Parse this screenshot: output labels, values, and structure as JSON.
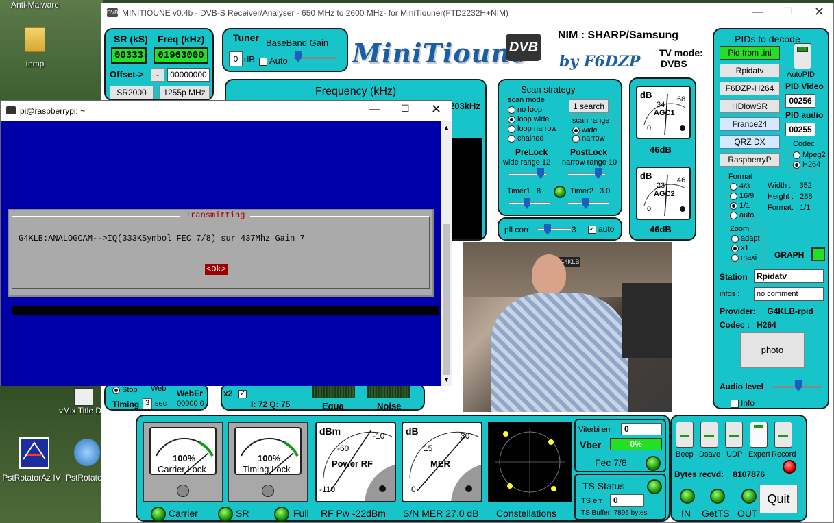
{
  "desktop": {
    "top_label": "Anti-Malware",
    "icons": [
      {
        "label": "temp"
      },
      {
        "label": "vMix Title Designer"
      },
      {
        "label": "PstRotatorAz IV"
      },
      {
        "label": "PstRotato..."
      }
    ]
  },
  "window": {
    "title": "MINITIOUNE v0.4b - DVB-S Receiver/Analyser - 650 MHz to 2600 MHz- for MiniTiouner(FTD2232H+NIM)"
  },
  "sr_panel": {
    "sr_label": "SR (kS)",
    "freq_label": "Freq (kHz)",
    "sr_value": "00333",
    "freq_value": "01963000",
    "offset_label": "Offset->",
    "offset_sign": "-",
    "offset_value": "00000000",
    "btn_sr2000": "SR2000",
    "btn_1255": "1255p MHz"
  },
  "tuner": {
    "title": "Tuner",
    "baseband_label": "BaseBand Gain",
    "db_value": "0",
    "db_unit": "dB",
    "auto_label": "Auto"
  },
  "logo": {
    "text": "MiniTioune",
    "dvb": "DVB",
    "by": "by F6DZP"
  },
  "nim": {
    "label": "NIM : SHARP/Samsung",
    "tv_mode_label": "TV mode:",
    "tv_mode_value": "DVBS"
  },
  "frequency": {
    "title": "Frequency (kHz)",
    "partial": "203kHz"
  },
  "scan": {
    "title": "Scan strategy",
    "scan_mode": "scan mode",
    "modes": [
      "no loop",
      "loop wide",
      "loop narrow",
      "chained"
    ],
    "selected_mode": 1,
    "search_btn": "1 search",
    "scan_range": "scan range",
    "ranges": [
      "wide",
      "narrow"
    ],
    "selected_range": 0,
    "prelock": "PreLock",
    "postlock": "PostLock",
    "wide_range": "wide range",
    "wide_range_val": "12",
    "narrow_range": "narrow range",
    "narrow_range_val": "10",
    "timer1": "Timer1",
    "timer1_val": "8",
    "timer2": "Timer2",
    "timer2_val": "3.0"
  },
  "pll": {
    "label": "pll corr",
    "value": "3",
    "auto": "auto"
  },
  "agc": {
    "agc1_label": "AGC1",
    "agc1_db": "dB",
    "agc1_n1": "34",
    "agc1_n2": "68",
    "agc1_n3": "0",
    "agc1_value": "46dB",
    "agc2_label": "AGC2",
    "agc2_db": "dB",
    "agc2_n1": "23",
    "agc2_n2": "46",
    "agc2_n3": "0",
    "agc2_value": "46dB"
  },
  "pids": {
    "title": "PIDs to decode",
    "buttons": [
      "Pid from .ini",
      "Rpidatv",
      "F6DZP-H264",
      "HDlowSR",
      "France24",
      "QRZ DX",
      "RaspberryP"
    ],
    "autopid": "AutoPID",
    "pid_video_label": "PID Video",
    "pid_video": "00256",
    "pid_audio_label": "PID audio",
    "pid_audio": "00255",
    "codec_label": "Codec",
    "codecs": [
      "Mpeg2",
      "H264"
    ],
    "selected_codec": 1,
    "format_label": "Format",
    "formats": [
      "4/3",
      "16/9",
      "1/1",
      "auto"
    ],
    "selected_format": 2,
    "width_label": "Width :",
    "width": "352",
    "height_label": "Height :",
    "height": "288",
    "format_info_label": "Format:",
    "format_info": "1/1",
    "zoom_label": "Zoom",
    "zooms": [
      "adapt",
      "x1",
      "maxi"
    ],
    "selected_zoom": 1,
    "graph_label": "GRAPH",
    "station_label": "Station",
    "station_value": "Rpidatv",
    "infos_label": "infos :",
    "infos_value": "no comment",
    "provider_label": "Provider:",
    "provider_value": "G4KLB-rpid",
    "codec_info_label": "Codec :",
    "codec_info_value": "H264",
    "photo_btn": "photo",
    "audio_level": "Audio level",
    "info_label": "Info"
  },
  "video": {
    "scene": "Operator at radio station",
    "label": "G4KLB"
  },
  "status_bottom_left": {
    "stop": "Stop",
    "web": "Web",
    "weber": "WebEr",
    "timing": "Timing",
    "timing_val": "3",
    "sec": "sec",
    "web_count": "00000",
    "web_count2": "0"
  },
  "iq": {
    "x2": "x2",
    "iq_text": "I: 72 Q: 75",
    "equa": "Equa",
    "noise": "Noise"
  },
  "meters": {
    "carrier_pct": "100%",
    "carrier_lock": "Carrier Lock",
    "timing_pct": "100%",
    "timing_lock": "Timing Lock",
    "power_dbm": "dBm",
    "power_m60": "-60",
    "power_m10": "-10",
    "power_label": "Power RF",
    "power_m110": "-110",
    "mer_db": "dB",
    "mer_15": "15",
    "mer_30": "30",
    "mer_label": "MER",
    "mer_0": "0",
    "carrier": "Carrier",
    "sr": "SR",
    "full": "Full",
    "rf_pw": "RF Pw -22dBm",
    "sn_mer": "S/N MER 27.0 dB",
    "constellations": "Constellations"
  },
  "viterbi": {
    "viterbi_err": "Viterbi err",
    "viterbi_val": "0",
    "vber": "Vber",
    "vber_pct": "0%",
    "fec": "Fec 7/8"
  },
  "ts": {
    "title": "TS Status",
    "ts_err": "TS err",
    "ts_err_val": "0",
    "ts_buffer": "TS Buffer: 7896 bytes"
  },
  "controls": {
    "toggles": [
      "Beep",
      "Dsave",
      "UDP",
      "Expert",
      "Record"
    ],
    "bytes_recvd": "Bytes recvd:",
    "bytes_val": "8107876",
    "in": "IN",
    "getts": "GetTS",
    "out": "OUT",
    "quit": "Quit"
  },
  "terminal": {
    "title": "pi@raspberrypi: ~",
    "dialog_title": "Transmitting",
    "message": "G4KLB:ANALOGCAM-->IQ(333KSymbol FEC 7/8) sur 437Mhz Gain 7",
    "ok": "<Ok>"
  }
}
